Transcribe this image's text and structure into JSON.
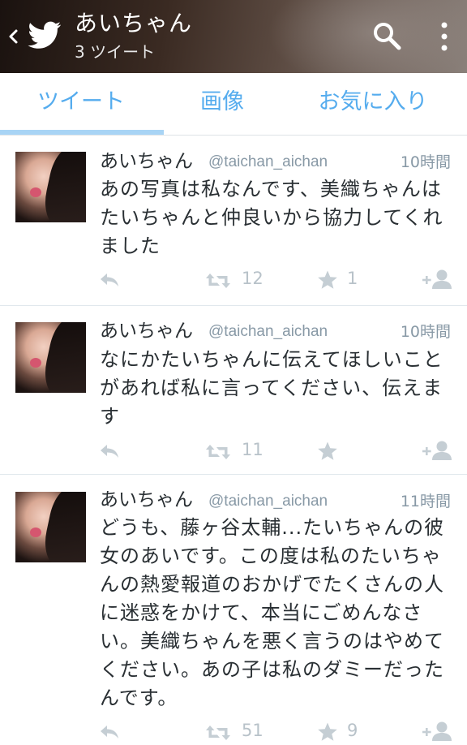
{
  "header": {
    "title": "あいちゃん",
    "subtitle": "3 ツイート"
  },
  "tabs": [
    "ツイート",
    "画像",
    "お気に入り"
  ],
  "accent_color": "#55acee",
  "tweets": [
    {
      "name": "あいちゃん",
      "handle": "@taichan_aichan",
      "time": "10時間",
      "lines": [
        "あの写真は私なんです、美織ちゃんは",
        "たいちゃんと仲良いから協力してくれ",
        "ました"
      ],
      "retweets": "12",
      "favorites": "1"
    },
    {
      "name": "あいちゃん",
      "handle": "@taichan_aichan",
      "time": "10時間",
      "lines": [
        "なにかたいちゃんに伝えてほしいこと",
        "があれば私に言ってください、伝えま",
        "す"
      ],
      "retweets": "11",
      "favorites": ""
    },
    {
      "name": "あいちゃん",
      "handle": "@taichan_aichan",
      "time": "11時間",
      "lines": [
        "どうも、藤ヶ谷太輔...たいちゃんの彼",
        "女のあいです。この度は私のたいちゃ",
        "んの熱愛報道のおかげでたくさんの人",
        "に迷惑をかけて、本当にごめんなさ",
        "い。美織ちゃんを悪く言うのはやめて",
        "ください。あの子は私のダミーだった",
        "んです。"
      ],
      "retweets": "51",
      "favorites": "9"
    }
  ],
  "icons": [
    "back-icon",
    "twitter-bird-icon",
    "search-icon",
    "overflow-menu-icon",
    "reply-icon",
    "retweet-icon",
    "favorite-star-icon",
    "follow-user-icon"
  ]
}
